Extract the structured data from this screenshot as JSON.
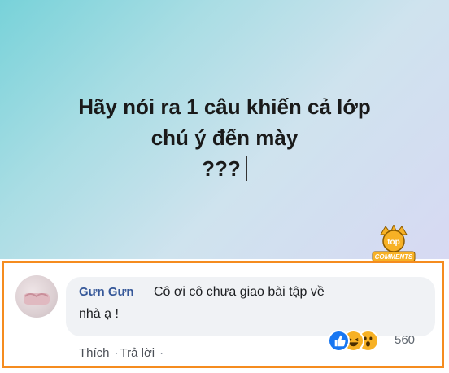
{
  "post": {
    "line1": "Hãy nói ra 1 câu khiến cả lớp",
    "line2": "chú ý đến mày",
    "line3": "???"
  },
  "badge": {
    "label_top": "top",
    "label_bottom": "COMMENTS"
  },
  "comment": {
    "author": "Gưn Gưn",
    "text_line1": "Cô ơi cô chưa giao bài tập về",
    "text_line2": "nhà ạ !",
    "reaction_count": "560",
    "reactions": [
      "like-icon",
      "haha-icon",
      "wow-icon"
    ],
    "actions": {
      "like": "Thích",
      "reply": "Trả lời",
      "separator": "·"
    }
  },
  "colors": {
    "highlight_border": "#f58c1f",
    "author_name": "#365899",
    "like_blue": "#1877f2",
    "reaction_yellow": "#f7b125"
  }
}
